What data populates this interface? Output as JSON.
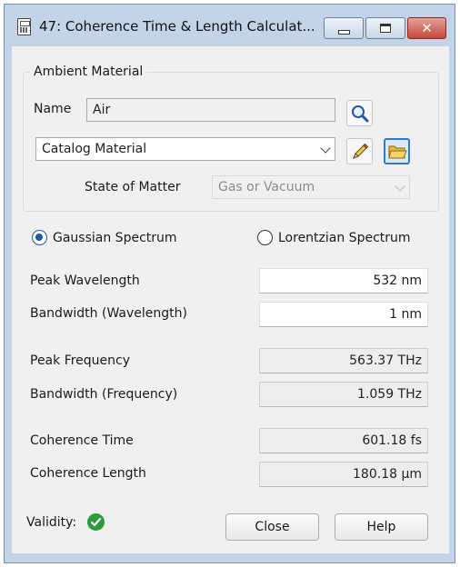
{
  "window": {
    "title": "47: Coherence Time & Length Calculat...",
    "minimize_icon": "minimize-icon",
    "maximize_icon": "maximize-icon",
    "close_icon": "close-icon",
    "close_glyph": "✕"
  },
  "ambient": {
    "group_label": "Ambient Material",
    "name_label": "Name",
    "name_value": "Air",
    "material_source": "Catalog Material",
    "state_label": "State of Matter",
    "state_value": "Gas or Vacuum",
    "search_icon": "magnifier-icon",
    "edit_icon": "pencil-icon",
    "open_icon": "folder-open-icon"
  },
  "spectrum": {
    "gaussian_label": "Gaussian Spectrum",
    "lorentzian_label": "Lorentzian Spectrum",
    "selected": "gaussian"
  },
  "fields": {
    "peak_wavelength_label": "Peak Wavelength",
    "peak_wavelength_value": "532 nm",
    "bandwidth_wavelength_label": "Bandwidth (Wavelength)",
    "bandwidth_wavelength_value": "1 nm",
    "peak_frequency_label": "Peak Frequency",
    "peak_frequency_value": "563.37 THz",
    "bandwidth_frequency_label": "Bandwidth (Frequency)",
    "bandwidth_frequency_value": "1.059 THz",
    "coherence_time_label": "Coherence Time",
    "coherence_time_value": "601.18 fs",
    "coherence_length_label": "Coherence Length",
    "coherence_length_value": "180.18 µm"
  },
  "footer": {
    "validity_label": "Validity:",
    "validity_icon": "checkmark-icon",
    "validity_color": "#2e9a3e",
    "close_label": "Close",
    "help_label": "Help"
  }
}
